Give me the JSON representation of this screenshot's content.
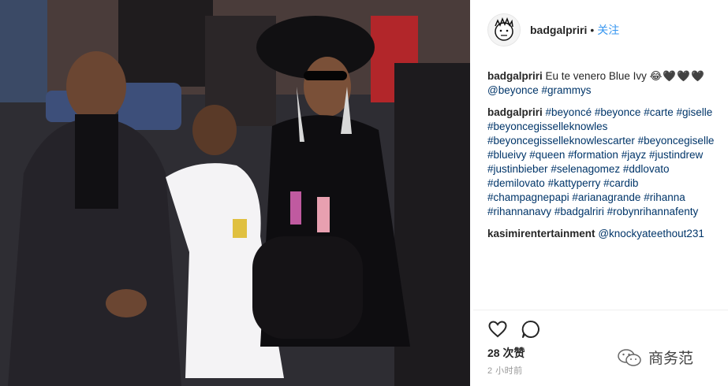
{
  "photo": {
    "description_icon": "photo-image"
  },
  "header": {
    "username": "badgalpriri",
    "separator": "•",
    "follow_label": "关注"
  },
  "caption": {
    "username": "badgalpriri",
    "text": "Eu te venero Blue Ivy",
    "emoji": "😂🖤🖤🖤",
    "mention": "@beyonce",
    "hashtag": "#grammys"
  },
  "hashtag_comment": {
    "username": "badgalpriri",
    "tags": [
      "#beyoncé",
      "#beyonce",
      "#carte",
      "#giselle",
      "#beyoncegisselleknowles",
      "#beyoncegisselleknowlescarter",
      "#beyoncegiselle",
      "#blueivy",
      "#queen",
      "#formation",
      "#jayz",
      "#justindrew",
      "#justinbieber",
      "#selenagomez",
      "#ddlovato",
      "#demilovato",
      "#kattyperry",
      "#cardib",
      "#champagnepapi",
      "#arianagrande",
      "#rihanna",
      "#rihannanavy",
      "#badgalriri",
      "#robynrihannafenty"
    ]
  },
  "reply_comment": {
    "username": "kasimirentertainment",
    "mention": "@knockyateethout231"
  },
  "actions": {
    "like_icon": "heart-icon",
    "comment_icon": "comment-bubble-icon"
  },
  "likes": {
    "count": "28",
    "label": "次赞"
  },
  "time_ago": "2 小时前",
  "watermark": {
    "text": "商务范",
    "icon": "wechat-icon"
  }
}
